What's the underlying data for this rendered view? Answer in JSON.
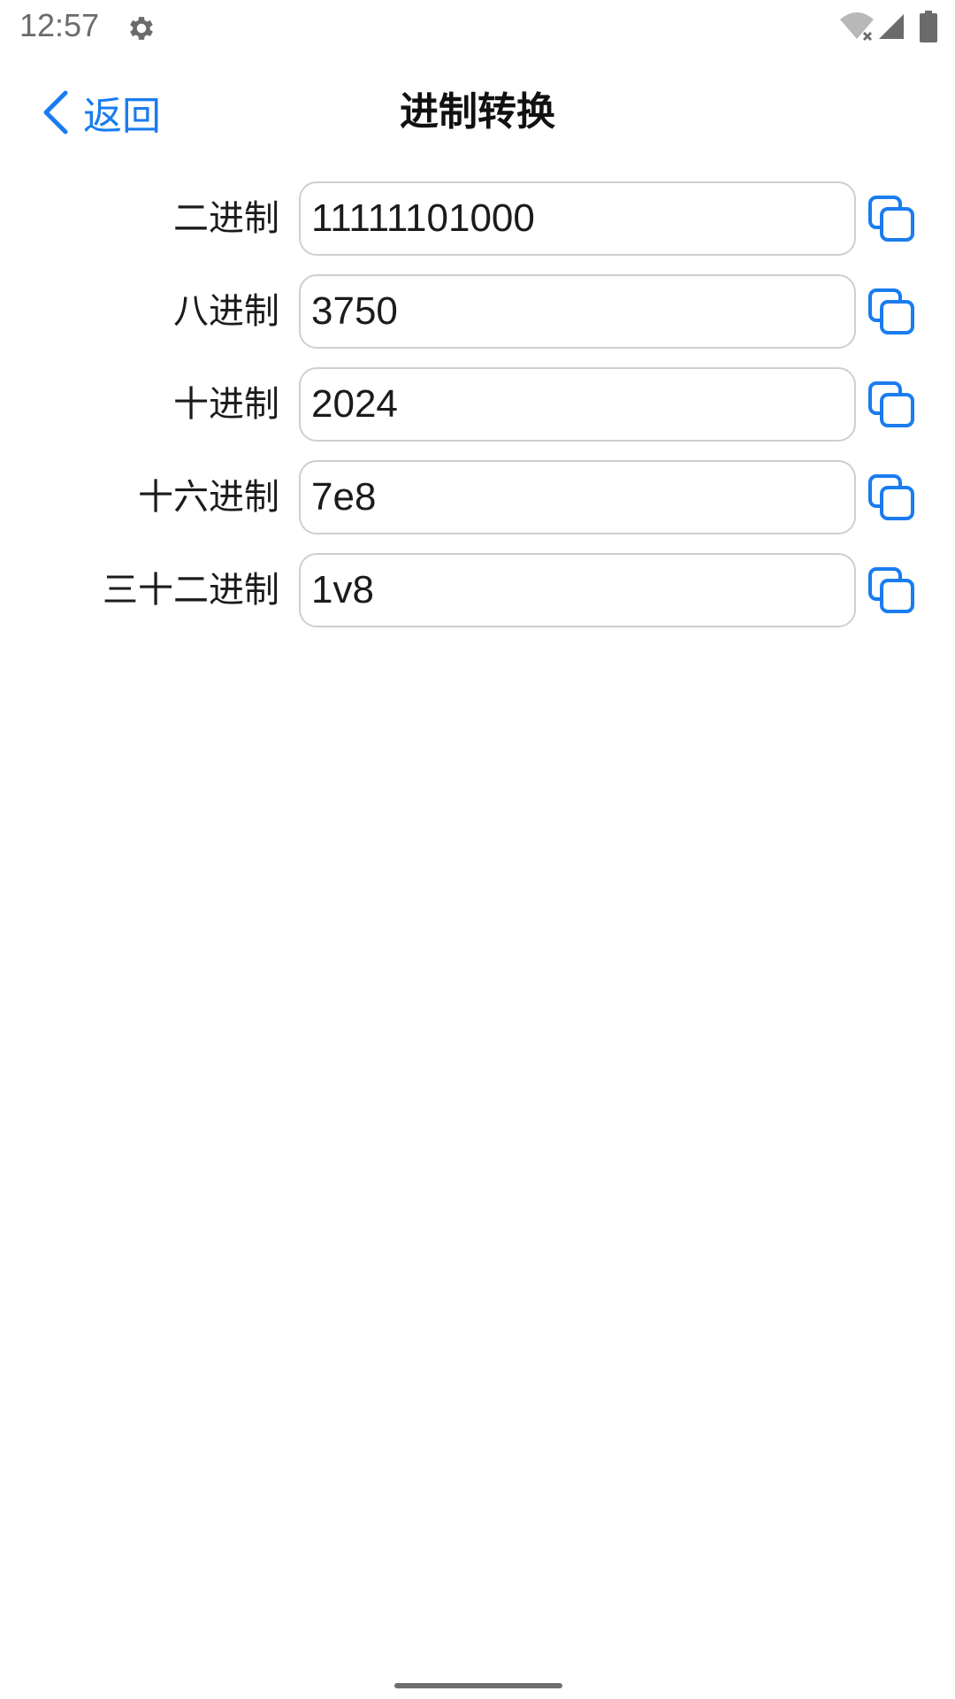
{
  "status_bar": {
    "time": "12:57",
    "settings_icon": "gear-icon",
    "wifi_icon": "wifi-off-icon",
    "signal_icon": "cell-signal-icon",
    "battery_icon": "battery-icon"
  },
  "nav": {
    "back_label": "返回",
    "back_icon": "chevron-left-icon",
    "title": "进制转换"
  },
  "rows": [
    {
      "label": "二进制",
      "value": "11111101000"
    },
    {
      "label": "八进制",
      "value": "3750"
    },
    {
      "label": "十进制",
      "value": "2024"
    },
    {
      "label": "十六进制",
      "value": "7e8"
    },
    {
      "label": "三十二进制",
      "value": "1v8"
    }
  ],
  "copy_icon": "copy-icon",
  "colors": {
    "accent": "#1a7cf0",
    "text": "#1b1b1b",
    "border": "#cfcfcf"
  }
}
